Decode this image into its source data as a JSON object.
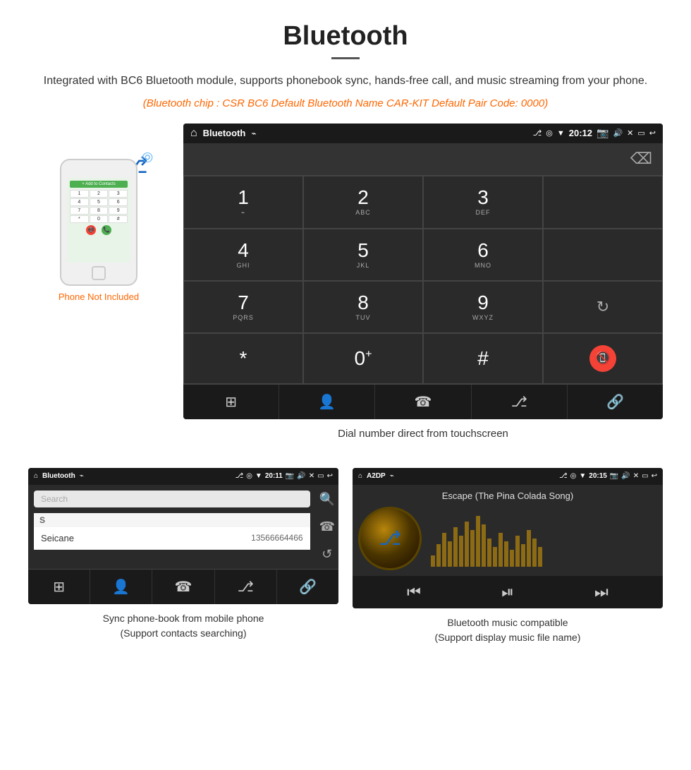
{
  "header": {
    "title": "Bluetooth",
    "description": "Integrated with BC6 Bluetooth module, supports phonebook sync, hands-free call, and music streaming from your phone.",
    "specs": "(Bluetooth chip : CSR BC6    Default Bluetooth Name CAR-KIT    Default Pair Code: 0000)"
  },
  "phone_note": "Phone Not Included",
  "dialpad_screen": {
    "title": "Bluetooth",
    "time": "20:12",
    "keys": [
      {
        "num": "1",
        "letters": "⌁"
      },
      {
        "num": "2",
        "letters": "ABC"
      },
      {
        "num": "3",
        "letters": "DEF"
      },
      {
        "num": "4",
        "letters": "GHI"
      },
      {
        "num": "5",
        "letters": "JKL"
      },
      {
        "num": "6",
        "letters": "MNO"
      },
      {
        "num": "7",
        "letters": "PQRS"
      },
      {
        "num": "8",
        "letters": "TUV"
      },
      {
        "num": "9",
        "letters": "WXYZ"
      },
      {
        "num": "*",
        "letters": ""
      },
      {
        "num": "0",
        "letters": "+"
      },
      {
        "num": "#",
        "letters": ""
      }
    ],
    "caption": "Dial number direct from touchscreen"
  },
  "contacts_screen": {
    "title": "Bluetooth",
    "time": "20:11",
    "search_placeholder": "Search",
    "contacts": [
      {
        "letter": "S",
        "name": "Seicane",
        "number": "13566664466"
      }
    ],
    "caption": "Sync phone-book from mobile phone\n(Support contacts searching)"
  },
  "music_screen": {
    "title": "A2DP",
    "time": "20:15",
    "song": "Escape (The Pina Colada Song)",
    "caption": "Bluetooth music compatible\n(Support display music file name)"
  }
}
